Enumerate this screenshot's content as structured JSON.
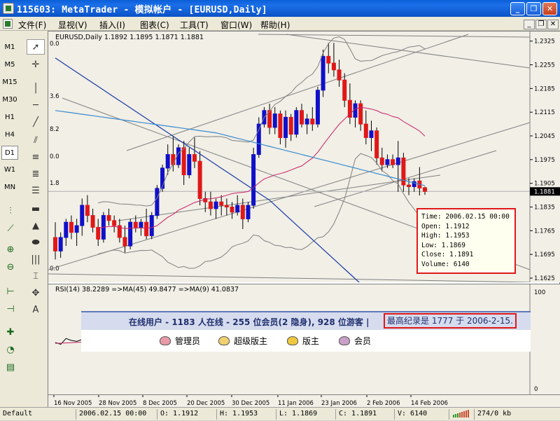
{
  "window": {
    "title": "115603: MetaTrader - 模拟帐户 - [EURUSD,Daily]",
    "buttons": [
      "_",
      "❐",
      "✕"
    ]
  },
  "menu": {
    "items": [
      "文件(F)",
      "显视(V)",
      "插入(I)",
      "图表(C)",
      "工具(T)",
      "窗口(W)",
      "帮助(H)"
    ],
    "mdi_buttons": [
      "_",
      "❐",
      "✕"
    ]
  },
  "timeframes": [
    "M1",
    "M5",
    "M15",
    "M30",
    "H1",
    "H4",
    "D1",
    "W1",
    "MN"
  ],
  "active_timeframe": "D1",
  "chart": {
    "header": "EURUSD,Daily  1.1892 1.1895 1.1871 1.1881",
    "rsi_header": "RSI(14) 38.2289  =>MA(45) 49.8477  =>MA(9) 41.0837",
    "current_price": "1.1881",
    "price_ticks": [
      "1.2325",
      "1.2255",
      "1.2185",
      "1.2115",
      "1.2045",
      "1.1975",
      "1.1905",
      "1.1835",
      "1.1765",
      "1.1695",
      "1.1625"
    ],
    "left_edge_labels": [
      "0.0",
      "3.6",
      "8.2",
      "0.0",
      "1.8",
      "0.0"
    ],
    "rsi_ticks": [
      "100",
      "0"
    ],
    "date_ticks": [
      "16 Nov 2005",
      "28 Nov 2005",
      "8 Dec 2005",
      "20 Dec 2005",
      "30 Dec 2005",
      "11 Jan 2006",
      "23 Jan 2006",
      "2 Feb 2006",
      "14 Feb 2006"
    ],
    "colors": {
      "bull": "#1010c8",
      "bear": "#e01818",
      "ma_blue": "#1838a8",
      "ma_light": "#3a8ad0",
      "ma_pink": "#c8206a",
      "bands": "#808080",
      "rsi": "#000000",
      "rsi_ma": "#c8206a"
    }
  },
  "tooltip": {
    "time": "Time: 2006.02.15 00:00",
    "open": "Open: 1.1912",
    "high": "High: 1.1953",
    "low": "Low: 1.1869",
    "close": "Close: 1.1891",
    "volume": "Volume: 6140"
  },
  "overlay": {
    "online_text": "在线用户 - 1183 人在线 - 255 位会员(2 隐身), 928 位游客 |",
    "record_text": "最高纪录是  1777 于  2006-2-15.",
    "groups": [
      {
        "label": "管理员",
        "color": "#e89aa8"
      },
      {
        "label": "超级版主",
        "color": "#f0d070"
      },
      {
        "label": "版主",
        "color": "#f0c840"
      },
      {
        "label": "会员",
        "color": "#c8a0c8"
      }
    ]
  },
  "status": {
    "profile": "Default",
    "time": "2006.02.15 00:00",
    "open": "O: 1.1912",
    "high": "H: 1.1953",
    "low": "L: 1.1869",
    "close": "C: 1.1891",
    "volume": "V: 6140",
    "traffic": "274/0 kb"
  },
  "chart_data": {
    "type": "candlestick",
    "symbol": "EURUSD",
    "timeframe": "Daily",
    "ylim": [
      1.1625,
      1.2345
    ],
    "candles": [
      {
        "o": 1.1745,
        "h": 1.179,
        "l": 1.168,
        "c": 1.1705
      },
      {
        "o": 1.1705,
        "h": 1.176,
        "l": 1.1685,
        "c": 1.1745
      },
      {
        "o": 1.1745,
        "h": 1.18,
        "l": 1.172,
        "c": 1.179
      },
      {
        "o": 1.179,
        "h": 1.181,
        "l": 1.174,
        "c": 1.176
      },
      {
        "o": 1.176,
        "h": 1.18,
        "l": 1.172,
        "c": 1.178
      },
      {
        "o": 1.178,
        "h": 1.186,
        "l": 1.175,
        "c": 1.184
      },
      {
        "o": 1.184,
        "h": 1.187,
        "l": 1.179,
        "c": 1.181
      },
      {
        "o": 1.181,
        "h": 1.183,
        "l": 1.176,
        "c": 1.1775
      },
      {
        "o": 1.1775,
        "h": 1.18,
        "l": 1.172,
        "c": 1.174
      },
      {
        "o": 1.174,
        "h": 1.182,
        "l": 1.173,
        "c": 1.181
      },
      {
        "o": 1.181,
        "h": 1.183,
        "l": 1.178,
        "c": 1.1795
      },
      {
        "o": 1.1795,
        "h": 1.181,
        "l": 1.176,
        "c": 1.178
      },
      {
        "o": 1.178,
        "h": 1.18,
        "l": 1.173,
        "c": 1.1745
      },
      {
        "o": 1.1745,
        "h": 1.178,
        "l": 1.17,
        "c": 1.172
      },
      {
        "o": 1.172,
        "h": 1.18,
        "l": 1.171,
        "c": 1.179
      },
      {
        "o": 1.179,
        "h": 1.181,
        "l": 1.176,
        "c": 1.1775
      },
      {
        "o": 1.1775,
        "h": 1.18,
        "l": 1.175,
        "c": 1.179
      },
      {
        "o": 1.179,
        "h": 1.183,
        "l": 1.174,
        "c": 1.175
      },
      {
        "o": 1.175,
        "h": 1.182,
        "l": 1.174,
        "c": 1.181
      },
      {
        "o": 1.181,
        "h": 1.19,
        "l": 1.18,
        "c": 1.189
      },
      {
        "o": 1.189,
        "h": 1.196,
        "l": 1.188,
        "c": 1.195
      },
      {
        "o": 1.195,
        "h": 1.202,
        "l": 1.193,
        "c": 1.199
      },
      {
        "o": 1.199,
        "h": 1.2045,
        "l": 1.194,
        "c": 1.196
      },
      {
        "o": 1.196,
        "h": 1.202,
        "l": 1.195,
        "c": 1.201
      },
      {
        "o": 1.201,
        "h": 1.203,
        "l": 1.19,
        "c": 1.193
      },
      {
        "o": 1.193,
        "h": 1.201,
        "l": 1.192,
        "c": 1.199
      },
      {
        "o": 1.199,
        "h": 1.204,
        "l": 1.195,
        "c": 1.197
      },
      {
        "o": 1.197,
        "h": 1.2,
        "l": 1.184,
        "c": 1.186
      },
      {
        "o": 1.186,
        "h": 1.188,
        "l": 1.182,
        "c": 1.185
      },
      {
        "o": 1.185,
        "h": 1.188,
        "l": 1.181,
        "c": 1.183
      },
      {
        "o": 1.183,
        "h": 1.186,
        "l": 1.18,
        "c": 1.185
      },
      {
        "o": 1.185,
        "h": 1.187,
        "l": 1.181,
        "c": 1.184
      },
      {
        "o": 1.184,
        "h": 1.186,
        "l": 1.181,
        "c": 1.1835
      },
      {
        "o": 1.1835,
        "h": 1.185,
        "l": 1.18,
        "c": 1.182
      },
      {
        "o": 1.182,
        "h": 1.187,
        "l": 1.181,
        "c": 1.184
      },
      {
        "o": 1.184,
        "h": 1.186,
        "l": 1.177,
        "c": 1.18
      },
      {
        "o": 1.18,
        "h": 1.185,
        "l": 1.179,
        "c": 1.184
      },
      {
        "o": 1.184,
        "h": 1.201,
        "l": 1.183,
        "c": 1.199
      },
      {
        "o": 1.199,
        "h": 1.21,
        "l": 1.198,
        "c": 1.208
      },
      {
        "o": 1.208,
        "h": 1.213,
        "l": 1.207,
        "c": 1.212
      },
      {
        "o": 1.212,
        "h": 1.214,
        "l": 1.205,
        "c": 1.207
      },
      {
        "o": 1.207,
        "h": 1.213,
        "l": 1.205,
        "c": 1.211
      },
      {
        "o": 1.211,
        "h": 1.212,
        "l": 1.202,
        "c": 1.204
      },
      {
        "o": 1.204,
        "h": 1.212,
        "l": 1.201,
        "c": 1.21
      },
      {
        "o": 1.21,
        "h": 1.211,
        "l": 1.203,
        "c": 1.205
      },
      {
        "o": 1.205,
        "h": 1.213,
        "l": 1.204,
        "c": 1.212
      },
      {
        "o": 1.212,
        "h": 1.214,
        "l": 1.207,
        "c": 1.208
      },
      {
        "o": 1.208,
        "h": 1.211,
        "l": 1.205,
        "c": 1.2095
      },
      {
        "o": 1.2095,
        "h": 1.213,
        "l": 1.206,
        "c": 1.208
      },
      {
        "o": 1.208,
        "h": 1.219,
        "l": 1.207,
        "c": 1.218
      },
      {
        "o": 1.218,
        "h": 1.23,
        "l": 1.216,
        "c": 1.228
      },
      {
        "o": 1.228,
        "h": 1.232,
        "l": 1.223,
        "c": 1.226
      },
      {
        "o": 1.226,
        "h": 1.232,
        "l": 1.222,
        "c": 1.224
      },
      {
        "o": 1.224,
        "h": 1.227,
        "l": 1.219,
        "c": 1.221
      },
      {
        "o": 1.221,
        "h": 1.223,
        "l": 1.213,
        "c": 1.215
      },
      {
        "o": 1.215,
        "h": 1.22,
        "l": 1.208,
        "c": 1.21
      },
      {
        "o": 1.21,
        "h": 1.215,
        "l": 1.207,
        "c": 1.214
      },
      {
        "o": 1.214,
        "h": 1.215,
        "l": 1.206,
        "c": 1.208
      },
      {
        "o": 1.208,
        "h": 1.212,
        "l": 1.202,
        "c": 1.204
      },
      {
        "o": 1.204,
        "h": 1.209,
        "l": 1.2,
        "c": 1.206
      },
      {
        "o": 1.206,
        "h": 1.207,
        "l": 1.196,
        "c": 1.198
      },
      {
        "o": 1.198,
        "h": 1.201,
        "l": 1.194,
        "c": 1.196
      },
      {
        "o": 1.196,
        "h": 1.199,
        "l": 1.195,
        "c": 1.1975
      },
      {
        "o": 1.1975,
        "h": 1.199,
        "l": 1.195,
        "c": 1.196
      },
      {
        "o": 1.196,
        "h": 1.203,
        "l": 1.188,
        "c": 1.198
      },
      {
        "o": 1.198,
        "h": 1.1995,
        "l": 1.188,
        "c": 1.19
      },
      {
        "o": 1.19,
        "h": 1.192,
        "l": 1.187,
        "c": 1.1895
      },
      {
        "o": 1.1895,
        "h": 1.192,
        "l": 1.188,
        "c": 1.191
      },
      {
        "o": 1.1912,
        "h": 1.1953,
        "l": 1.1869,
        "c": 1.1891
      },
      {
        "o": 1.1892,
        "h": 1.1895,
        "l": 1.1871,
        "c": 1.1881
      }
    ],
    "rsi": [
      48,
      46,
      52,
      50,
      49,
      51,
      53,
      52,
      50,
      49,
      51,
      54,
      56,
      55,
      57,
      58,
      56,
      55,
      57,
      59,
      60,
      58,
      61,
      62
    ]
  }
}
